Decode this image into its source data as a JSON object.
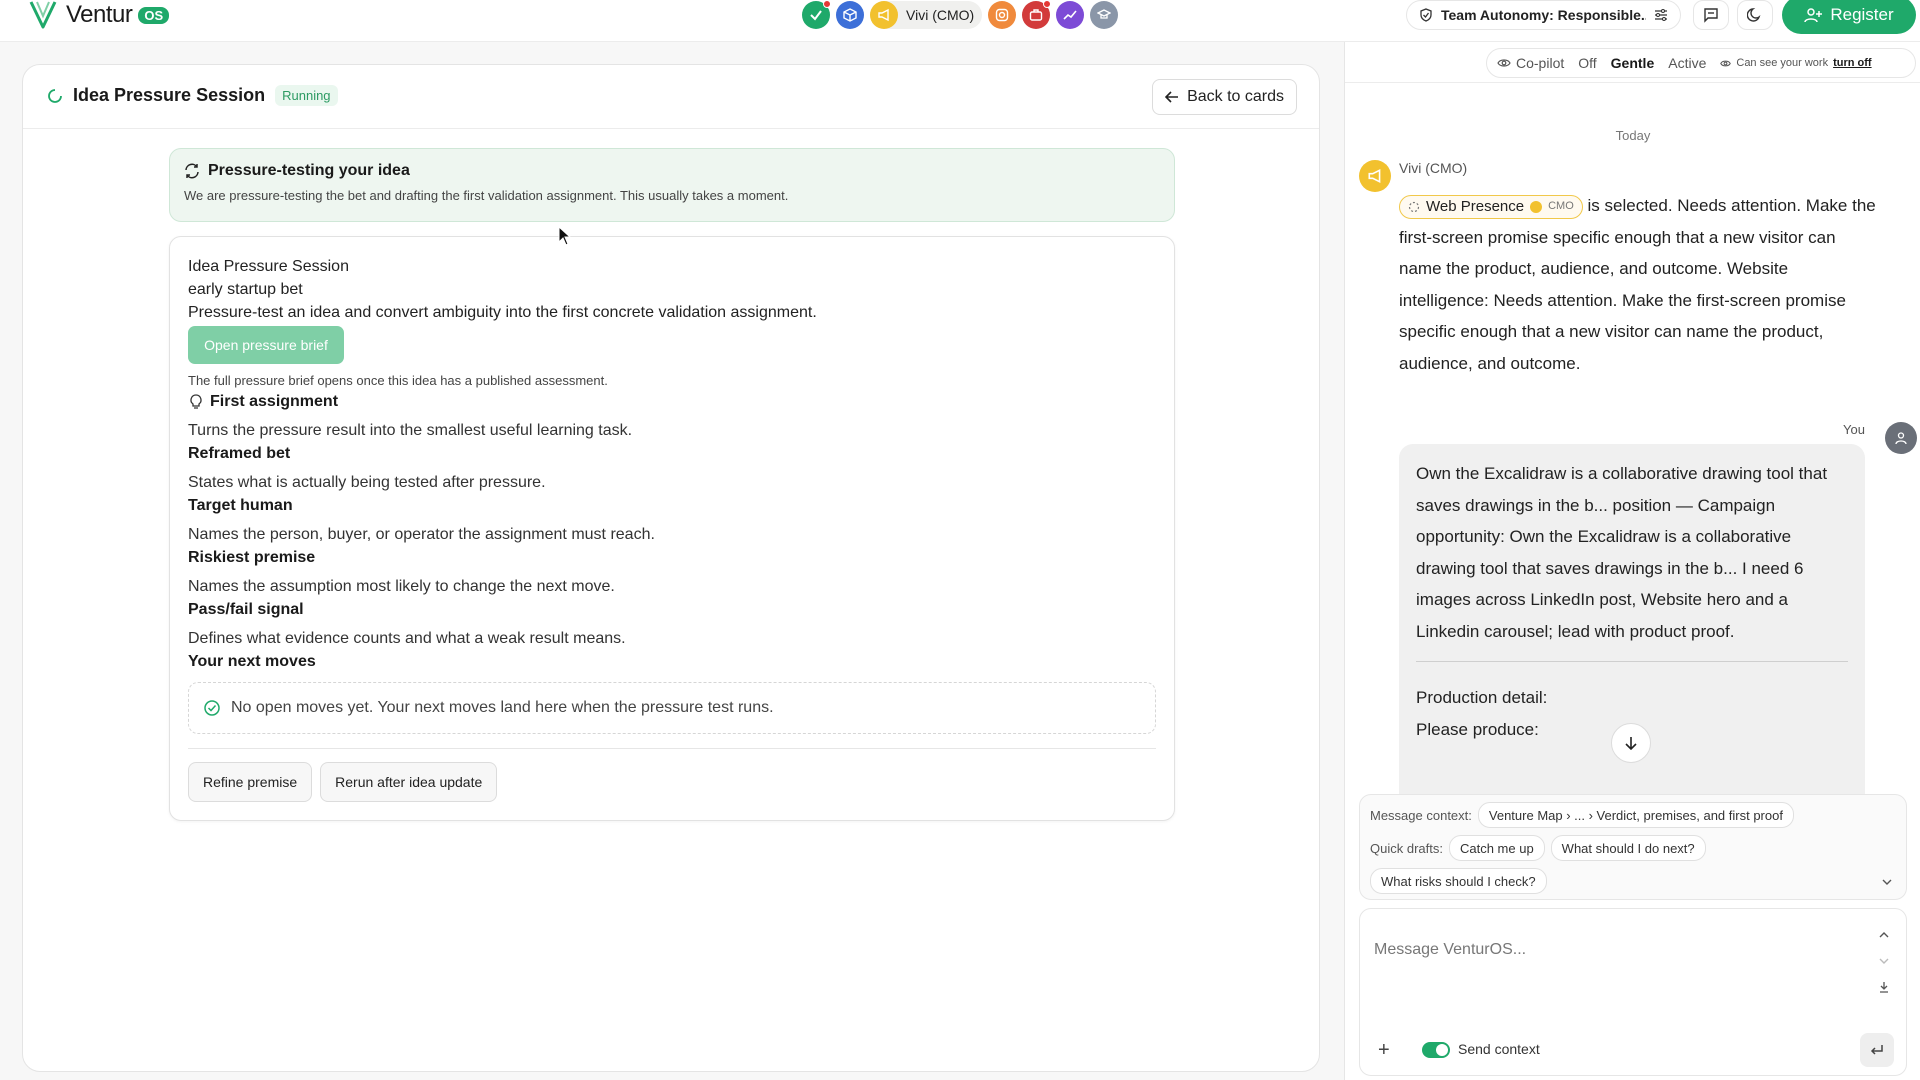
{
  "brand": {
    "name": "Ventur",
    "badge": "OS",
    "accent": "#1fa96a"
  },
  "header": {
    "agents": [
      {
        "icon": "check-icon",
        "color": "#1fa96a",
        "notify": true
      },
      {
        "icon": "cube-icon",
        "color": "#3c6fd8",
        "notify": false
      },
      {
        "icon": "megaphone-icon",
        "color": "#f2c12e",
        "notify": false
      }
    ],
    "active_agent_label": "Vivi (CMO)",
    "agents_after": [
      {
        "icon": "instagram-icon",
        "color": "#f08a3c",
        "notify": false
      },
      {
        "icon": "briefcase-icon",
        "color": "#d23b3b",
        "notify": true
      },
      {
        "icon": "trend-icon",
        "color": "#7d4bd6",
        "notify": false
      },
      {
        "icon": "graduation-cap-icon",
        "color": "#8a96a8",
        "notify": false
      }
    ],
    "team_label": "Team Autonomy: Responsible...",
    "register_label": "Register"
  },
  "session": {
    "title": "Idea Pressure Session",
    "status": "Running",
    "back_label": "Back to cards"
  },
  "progress": {
    "title": "Pressure-testing your idea",
    "description": "We are pressure-testing the bet and drafting the first validation assignment. This usually takes a moment."
  },
  "card": {
    "title": "Idea Pressure Session",
    "subtitle": "early startup bet",
    "description": "Pressure-test an idea and convert ambiguity into the first concrete validation assignment.",
    "open_brief_label": "Open pressure brief",
    "brief_note": "The full pressure brief opens once this idea has a published assessment.",
    "sections": [
      {
        "heading": "First assignment",
        "text": "Turns the pressure result into the smallest useful learning task."
      },
      {
        "heading": "Reframed bet",
        "text": "States what is actually being tested after pressure."
      },
      {
        "heading": "Target human",
        "text": "Names the person, buyer, or operator the assignment must reach."
      },
      {
        "heading": "Riskiest premise",
        "text": "Names the assumption most likely to change the next move."
      },
      {
        "heading": "Pass/fail signal",
        "text": "Defines what evidence counts and what a weak result means."
      }
    ],
    "moves_heading": "Your next moves",
    "empty_moves": "No open moves yet. Your next moves land here when the pressure test runs.",
    "actions": [
      "Refine premise",
      "Rerun after idea update"
    ]
  },
  "copilot": {
    "label": "Co-pilot",
    "modes": [
      "Off",
      "Gentle",
      "Active"
    ],
    "selected_mode": "Gentle",
    "visibility_note": "Can see your work",
    "turn_off": "turn off"
  },
  "chat": {
    "day": "Today",
    "agent_name": "Vivi (CMO)",
    "chip_label": "Web Presence",
    "chip_role": "CMO",
    "agent_message": "is selected. Needs attention. Make the first-screen promise specific enough that a new visitor can name the product, audience, and outcome. Website intelligence: Needs attention. Make the first-screen promise specific enough that a new visitor can name the product, audience, and outcome.",
    "you_label": "You",
    "user_message": "Own the Excalidraw is a collaborative drawing tool that saves drawings in the b... position — Campaign opportunity: Own the Excalidraw is a collaborative drawing tool that saves drawings in the b... I need 6 images across LinkedIn post, Website hero and a Linkedin carousel; lead with product proof.",
    "production_detail": "Production detail:",
    "please_produce": "Please produce:"
  },
  "context": {
    "message_context_label": "Message context:",
    "message_context_value": "Venture Map › ... › Verdict, premises, and first proof",
    "quick_drafts_label": "Quick drafts:",
    "quick_drafts": [
      "Catch me up",
      "What should I do next?",
      "What risks should I check?"
    ]
  },
  "composer": {
    "placeholder": "Message VenturOS...",
    "send_context_label": "Send context"
  }
}
